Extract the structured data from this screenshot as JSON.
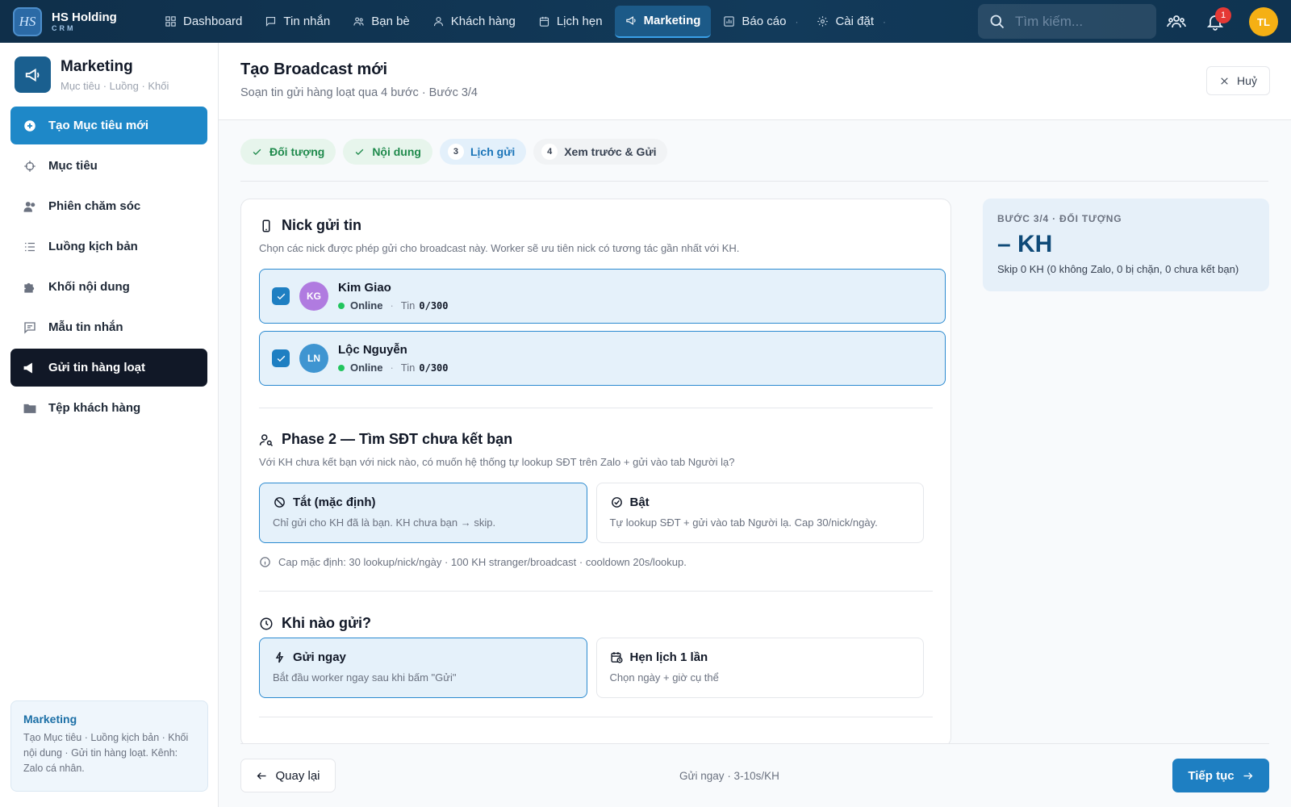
{
  "brand": {
    "logo": "HS",
    "name": "HS Holding",
    "sub": "CRM"
  },
  "nav": [
    {
      "label": "Dashboard",
      "icon": "grid-icon"
    },
    {
      "label": "Tin nhắn",
      "icon": "message-icon"
    },
    {
      "label": "Bạn bè",
      "icon": "friends-icon"
    },
    {
      "label": "Khách hàng",
      "icon": "user-icon"
    },
    {
      "label": "Lịch hẹn",
      "icon": "calendar-icon"
    },
    {
      "label": "Marketing",
      "icon": "megaphone-icon",
      "active": true
    },
    {
      "label": "Báo cáo",
      "icon": "chart-icon"
    },
    {
      "label": "Cài đặt",
      "icon": "gear-icon"
    }
  ],
  "search": {
    "placeholder": "Tìm kiếm..."
  },
  "notifications": {
    "count": "1"
  },
  "user": {
    "initials": "TL"
  },
  "sidebar": {
    "title": "Marketing",
    "subtitle": "Mục tiêu · Luồng · Khối",
    "items": [
      {
        "label": "Tạo Mục tiêu mới",
        "icon": "plus-circle-icon"
      },
      {
        "label": "Mục tiêu",
        "icon": "target-icon"
      },
      {
        "label": "Phiên chăm sóc",
        "icon": "users-icon"
      },
      {
        "label": "Luồng kịch bản",
        "icon": "list-icon"
      },
      {
        "label": "Khối nội dung",
        "icon": "puzzle-icon"
      },
      {
        "label": "Mẫu tin nhắn",
        "icon": "message-icon"
      },
      {
        "label": "Gửi tin hàng loạt",
        "icon": "megaphone-icon"
      },
      {
        "label": "Tệp khách hàng",
        "icon": "folder-user-icon"
      }
    ],
    "footer_title": "Marketing",
    "footer_desc": "Tạo Mục tiêu · Luồng kịch bản · Khối nội dung · Gửi tin hàng loạt. Kênh: Zalo cá nhân."
  },
  "page": {
    "title": "Tạo Broadcast mới",
    "subtitle": "Soạn tin gửi hàng loạt qua 4 bước · Bước 3/4",
    "cancel": "Huỷ"
  },
  "steps": [
    {
      "label": "Đối tượng",
      "state": "done"
    },
    {
      "label": "Nội dung",
      "state": "done"
    },
    {
      "num": "3",
      "label": "Lịch gửi",
      "state": "current"
    },
    {
      "num": "4",
      "label": "Xem trước & Gửi",
      "state": "todo"
    }
  ],
  "nick_section": {
    "title": "Nick gửi tin",
    "desc": "Chọn các nick được phép gửi cho broadcast này. Worker sẽ ưu tiên nick có tương tác gần nhất với KH.",
    "nicks": [
      {
        "initials": "KG",
        "name": "Kim Giao",
        "status": "Online",
        "quota_label": "Tin",
        "quota": "0/300",
        "color": "#b07be0"
      },
      {
        "initials": "LN",
        "name": "Lộc Nguyễn",
        "status": "Online",
        "quota_label": "Tin",
        "quota": "0/300",
        "color": "#3f95d1"
      }
    ]
  },
  "phase2": {
    "title": "Phase 2 — Tìm SĐT chưa kết bạn",
    "desc": "Với KH chưa kết bạn với nick nào, có muốn hệ thống tự lookup SĐT trên Zalo + gửi vào tab Người lạ?",
    "off_title": "Tắt (mặc định)",
    "off_desc": "Chỉ gửi cho KH đã là bạn. KH chưa bạn → skip.",
    "on_title": "Bật",
    "on_desc": "Tự lookup SĐT + gửi vào tab Người lạ. Cap 30/nick/ngày.",
    "note": "Cap mặc định: 30 lookup/nick/ngày · 100 KH stranger/broadcast · cooldown 20s/lookup."
  },
  "when": {
    "title": "Khi nào gửi?",
    "now_title": "Gửi ngay",
    "now_desc": "Bắt đầu worker ngay sau khi bấm \"Gửi\"",
    "sched_title": "Hẹn lịch 1 lần",
    "sched_desc": "Chọn ngày + giờ cụ thể"
  },
  "summary": {
    "label": "BƯỚC 3/4 · ĐỐI TƯỢNG",
    "value": "–  KH",
    "desc": "Skip 0 KH (0 không Zalo, 0 bị chặn, 0 chưa kết bạn)"
  },
  "footer": {
    "back": "Quay lại",
    "mid": "Gửi ngay · 3-10s/KH",
    "next": "Tiếp tục"
  },
  "colors": {
    "accent": "#1e7fc2",
    "nav_bg": "#0f2f4a",
    "done": "#1f8a4c"
  }
}
